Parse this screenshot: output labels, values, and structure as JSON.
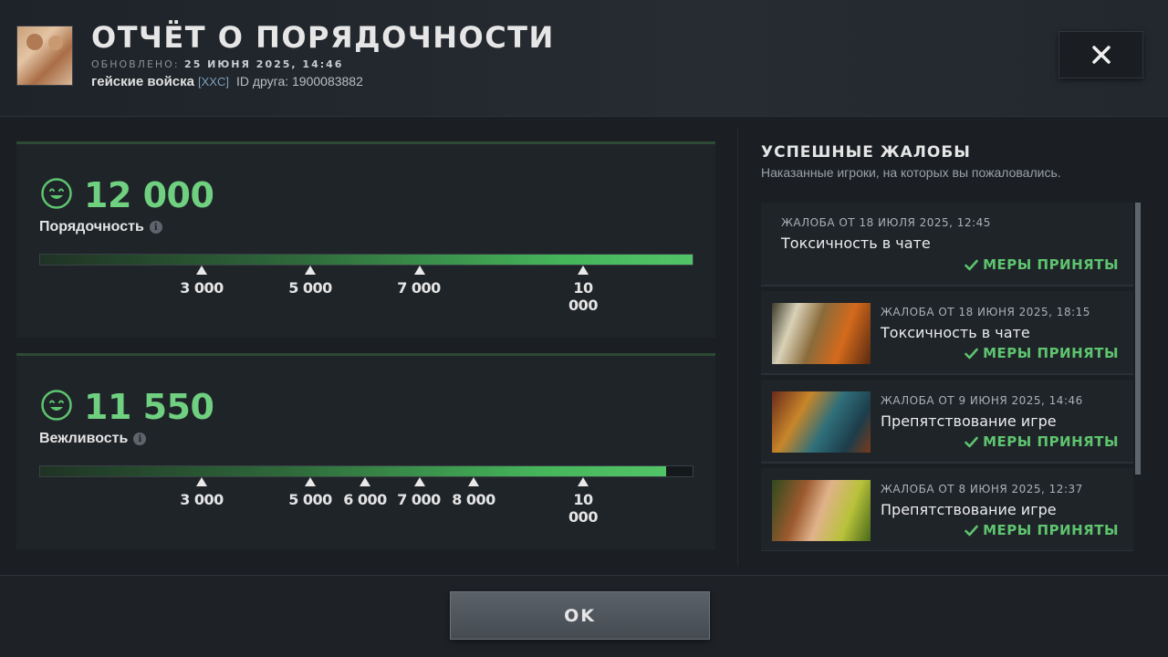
{
  "header": {
    "title": "ОТЧЁТ О ПОРЯДОЧНОСТИ",
    "updated_label": "ОБНОВЛЕНО:",
    "updated_value": "25 ИЮНЯ 2025, 14:46",
    "player_name": "гейские войска",
    "player_tag": "[XXC]",
    "friend_id": "ID друга: 1900083882"
  },
  "behavior": {
    "score": "12 000",
    "label": "Порядочность",
    "fill": 1.0,
    "ticks": [
      "3 000",
      "5 000",
      "7 000",
      "10 000"
    ]
  },
  "communication": {
    "score": "11 550",
    "label": "Вежливость",
    "fill": 0.96,
    "ticks": [
      "3 000",
      "5 000",
      "6 000",
      "7 000",
      "8 000",
      "10 000"
    ]
  },
  "reports_section": {
    "title": "УСПЕШНЫЕ ЖАЛОБЫ",
    "subtitle": "Наказанные игроки, на которых вы пожаловались.",
    "items": [
      {
        "date": "ЖАЛОБА ОТ 18 ИЮЛЯ 2025, 12:45",
        "reason": "Токсичность в чате",
        "status": "МЕРЫ ПРИНЯТЫ"
      },
      {
        "date": "ЖАЛОБА ОТ 18 ИЮНЯ 2025, 18:15",
        "reason": "Токсичность в чате",
        "status": "МЕРЫ ПРИНЯТЫ"
      },
      {
        "date": "ЖАЛОБА ОТ 9 ИЮНЯ 2025, 14:46",
        "reason": "Препятствование игре",
        "status": "МЕРЫ ПРИНЯТЫ"
      },
      {
        "date": "ЖАЛОБА ОТ 8 ИЮНЯ 2025, 12:37",
        "reason": "Препятствование игре",
        "status": "МЕРЫ ПРИНЯТЫ"
      }
    ]
  },
  "footer": {
    "ok_label": "OK"
  },
  "colors": {
    "score_green": "#6fd080",
    "status_green": "#5ec46e"
  }
}
